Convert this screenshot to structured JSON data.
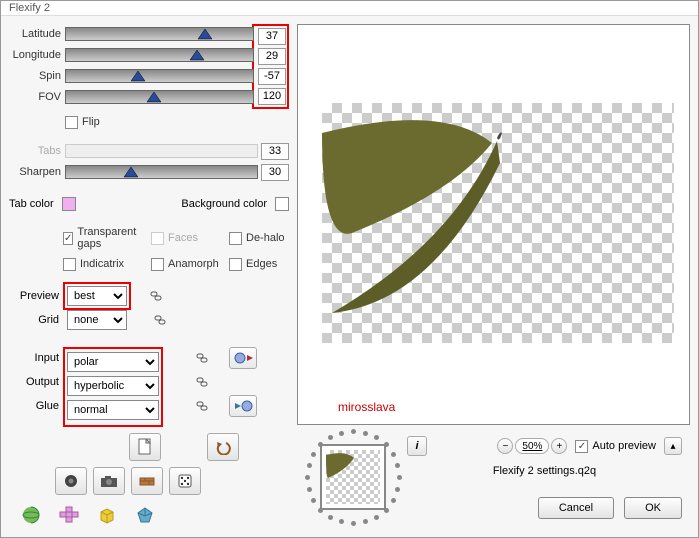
{
  "window": {
    "title": "Flexify 2"
  },
  "sliders": {
    "latitude": {
      "label": "Latitude",
      "value": "37",
      "thumb_pct": 70
    },
    "longitude": {
      "label": "Longitude",
      "value": "29",
      "thumb_pct": 66
    },
    "spin": {
      "label": "Spin",
      "value": "-57",
      "thumb_pct": 34
    },
    "fov": {
      "label": "FOV",
      "value": "120",
      "thumb_pct": 43
    },
    "tabs": {
      "label": "Tabs",
      "value": "33",
      "thumb_pct": 33
    },
    "sharpen": {
      "label": "Sharpen",
      "value": "30",
      "thumb_pct": 30
    }
  },
  "flip": {
    "label": "Flip",
    "checked": false
  },
  "colors": {
    "tab_label": "Tab color",
    "tab_swatch": "#f0b0f0",
    "bg_label": "Background color",
    "bg_swatch": "#ffffff"
  },
  "checks": {
    "transparent_gaps": {
      "label": "Transparent gaps",
      "checked": true
    },
    "faces": {
      "label": "Faces",
      "checked": false,
      "disabled": true
    },
    "dehalo": {
      "label": "De-halo",
      "checked": false
    },
    "indicatrix": {
      "label": "Indicatrix",
      "checked": false
    },
    "anamorph": {
      "label": "Anamorph",
      "checked": false
    },
    "edges": {
      "label": "Edges",
      "checked": false
    }
  },
  "selects": {
    "preview": {
      "label": "Preview",
      "value": "best"
    },
    "grid": {
      "label": "Grid",
      "value": "none"
    },
    "input": {
      "label": "Input",
      "value": "polar"
    },
    "output": {
      "label": "Output",
      "value": "hyperbolic"
    },
    "glue": {
      "label": "Glue",
      "value": "normal"
    }
  },
  "credit": "mirosslava",
  "zoom": {
    "value": "50%"
  },
  "auto_preview": {
    "label": "Auto preview",
    "checked": true
  },
  "settings_file": "Flexify 2 settings.q2q",
  "buttons": {
    "cancel": "Cancel",
    "ok": "OK"
  }
}
